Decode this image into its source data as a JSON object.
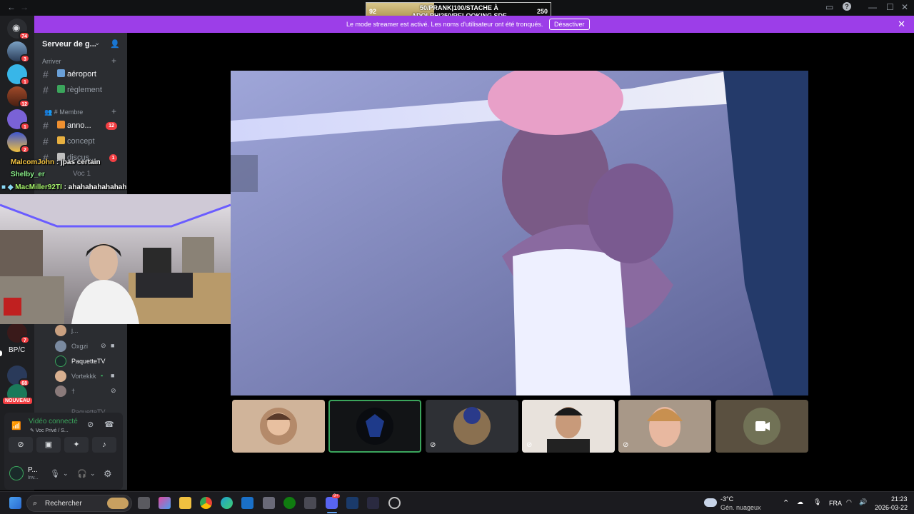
{
  "overlay_widget": {
    "left_value": "92",
    "text": "50/PRANK|100/STACHE À ADOLPH|250/RELOOKING SDF",
    "right_value": "250",
    "fill_fraction": 0.37
  },
  "banner": {
    "message": "Le mode streamer est activé. Les noms d'utilisateur ont été tronqués.",
    "button_label": "Désactiver"
  },
  "rail": {
    "badges": [
      "74",
      "3",
      "1",
      "12",
      "1",
      "2"
    ],
    "lower_badges": [
      "7",
      "68"
    ],
    "folder_label": "BP/C",
    "new_label": "NOUVEAU"
  },
  "server": {
    "name": "Serveur de g...",
    "categories": [
      "Arriver",
      "Membre"
    ],
    "channels": [
      {
        "name": "aéroport",
        "unread": true
      },
      {
        "name": "règlement",
        "unread": false
      },
      {
        "name": "anno...",
        "unread": true,
        "count": "12"
      },
      {
        "name": "concept",
        "unread": false
      },
      {
        "name": "discus...",
        "unread": false,
        "count": "1"
      }
    ],
    "voice_channel": "Voc 1"
  },
  "chat": [
    {
      "user": "MalcomJohn",
      "sep": " : ",
      "msg": "jpas certain",
      "color": "#f5c542"
    },
    {
      "user": "Shelby_er",
      "sep": "",
      "msg": "",
      "color": "#8ef58e"
    },
    {
      "user": "MacMiller92TI",
      "sep": " : ",
      "msg": "ahahahahahahah",
      "color": "#a8f56e"
    }
  ],
  "voice_users": [
    {
      "name": "j..."
    },
    {
      "name": "Oxgzi"
    },
    {
      "name": "PaquetteTV"
    },
    {
      "name": "Vortekkk"
    },
    {
      "name": "†"
    },
    {
      "name": "PaquetteTV"
    }
  ],
  "voice_panel": {
    "status": "Vidéo connecté",
    "channel": "Voc Privé / S...",
    "user": "P...",
    "user_status": "Inv..."
  },
  "taskbar": {
    "search_placeholder": "Rechercher",
    "discord_badge": "9+",
    "weather_temp": "-3°C",
    "weather_desc": "Gén. nuageux",
    "language": "FRA",
    "time": "21:23",
    "date": "2026-03-22"
  }
}
